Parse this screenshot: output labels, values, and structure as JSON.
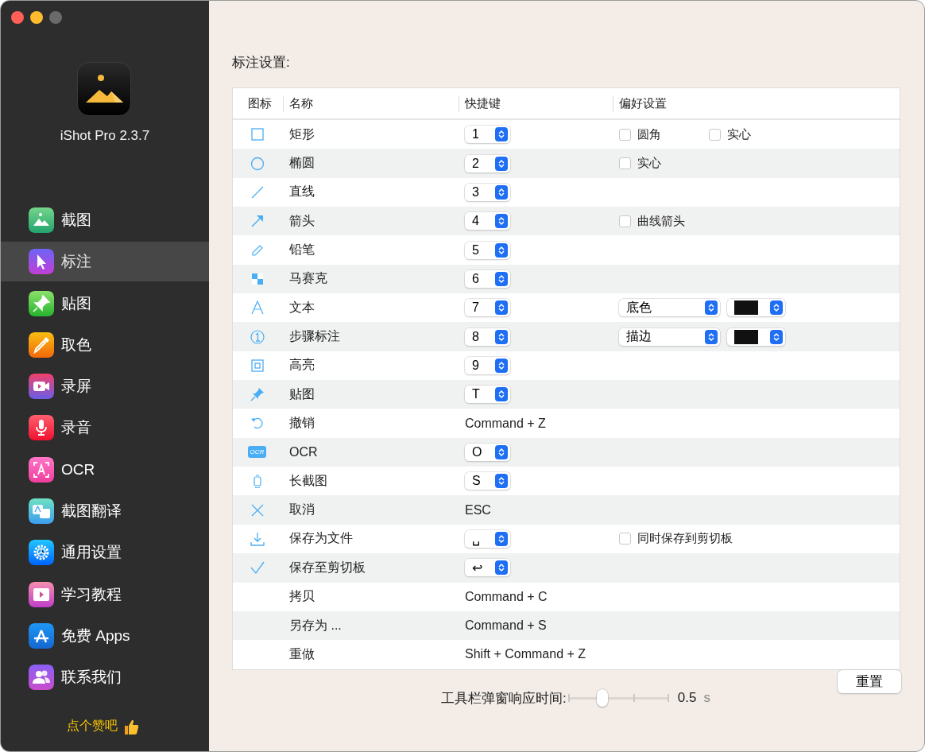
{
  "window": {
    "app_name": "iShot Pro 2.3.7"
  },
  "sidebar": {
    "items": [
      {
        "label": "截图",
        "selected": false
      },
      {
        "label": "标注",
        "selected": true
      },
      {
        "label": "贴图",
        "selected": false
      },
      {
        "label": "取色",
        "selected": false
      },
      {
        "label": "录屏",
        "selected": false
      },
      {
        "label": "录音",
        "selected": false
      },
      {
        "label": "OCR",
        "selected": false
      },
      {
        "label": "截图翻译",
        "selected": false
      },
      {
        "label": "通用设置",
        "selected": false
      },
      {
        "label": "学习教程",
        "selected": false
      },
      {
        "label": "免费 Apps",
        "selected": false
      },
      {
        "label": "联系我们",
        "selected": false
      }
    ],
    "like_label": "点个赞吧"
  },
  "section_title": "标注设置:",
  "table": {
    "columns": [
      "图标",
      "名称",
      "快捷键",
      "偏好设置"
    ],
    "rows": [
      {
        "name": "矩形",
        "shortcut": {
          "kind": "popup",
          "value": "1"
        },
        "prefs": [
          {
            "kind": "checkbox",
            "label": "圆角",
            "checked": false
          },
          {
            "kind": "checkbox",
            "label": "实心",
            "checked": false
          }
        ]
      },
      {
        "name": "椭圆",
        "shortcut": {
          "kind": "popup",
          "value": "2"
        },
        "prefs": [
          {
            "kind": "checkbox",
            "label": "实心",
            "checked": false
          }
        ]
      },
      {
        "name": "直线",
        "shortcut": {
          "kind": "popup",
          "value": "3"
        },
        "prefs": []
      },
      {
        "name": "箭头",
        "shortcut": {
          "kind": "popup",
          "value": "4"
        },
        "prefs": [
          {
            "kind": "checkbox",
            "label": "曲线箭头",
            "checked": false
          }
        ]
      },
      {
        "name": "铅笔",
        "shortcut": {
          "kind": "popup",
          "value": "5"
        },
        "prefs": []
      },
      {
        "name": "马赛克",
        "shortcut": {
          "kind": "popup",
          "value": "6"
        },
        "prefs": []
      },
      {
        "name": "文本",
        "shortcut": {
          "kind": "popup",
          "value": "7"
        },
        "prefs": [
          {
            "kind": "select",
            "value": "底色"
          },
          {
            "kind": "color",
            "color": "#111111"
          }
        ]
      },
      {
        "name": "步骤标注",
        "shortcut": {
          "kind": "popup",
          "value": "8"
        },
        "prefs": [
          {
            "kind": "select",
            "value": "描边"
          },
          {
            "kind": "color",
            "color": "#111111"
          }
        ]
      },
      {
        "name": "高亮",
        "shortcut": {
          "kind": "popup",
          "value": "9"
        },
        "prefs": []
      },
      {
        "name": "贴图",
        "shortcut": {
          "kind": "popup",
          "value": "T"
        },
        "prefs": []
      },
      {
        "name": "撤销",
        "shortcut": {
          "kind": "text",
          "value": "Command + Z"
        },
        "prefs": []
      },
      {
        "icon_label": "OCR",
        "name": "OCR",
        "shortcut": {
          "kind": "popup",
          "value": "O"
        },
        "prefs": []
      },
      {
        "name": "长截图",
        "shortcut": {
          "kind": "popup",
          "value": "S"
        },
        "prefs": []
      },
      {
        "name": "取消",
        "shortcut": {
          "kind": "text",
          "value": "ESC"
        },
        "prefs": []
      },
      {
        "name": "保存为文件",
        "shortcut": {
          "kind": "popup",
          "value": "␣"
        },
        "prefs": [
          {
            "kind": "checkbox",
            "label": "同时保存到剪切板",
            "checked": false
          }
        ]
      },
      {
        "name": "保存至剪切板",
        "shortcut": {
          "kind": "popup",
          "value": "↩"
        },
        "prefs": []
      },
      {
        "name": "拷贝",
        "shortcut": {
          "kind": "text",
          "value": "Command + C"
        },
        "prefs": []
      },
      {
        "name": "另存为 ...",
        "shortcut": {
          "kind": "text",
          "value": "Command + S"
        },
        "prefs": []
      },
      {
        "name": "重做",
        "shortcut": {
          "kind": "text",
          "value": "Shift + Command + Z"
        },
        "prefs": []
      }
    ]
  },
  "footer": {
    "slider_label": "工具栏弹窗响应时间:",
    "slider": {
      "level": 0.34
    },
    "reading": "0.5",
    "unit": "s",
    "reset_button": "重置"
  }
}
